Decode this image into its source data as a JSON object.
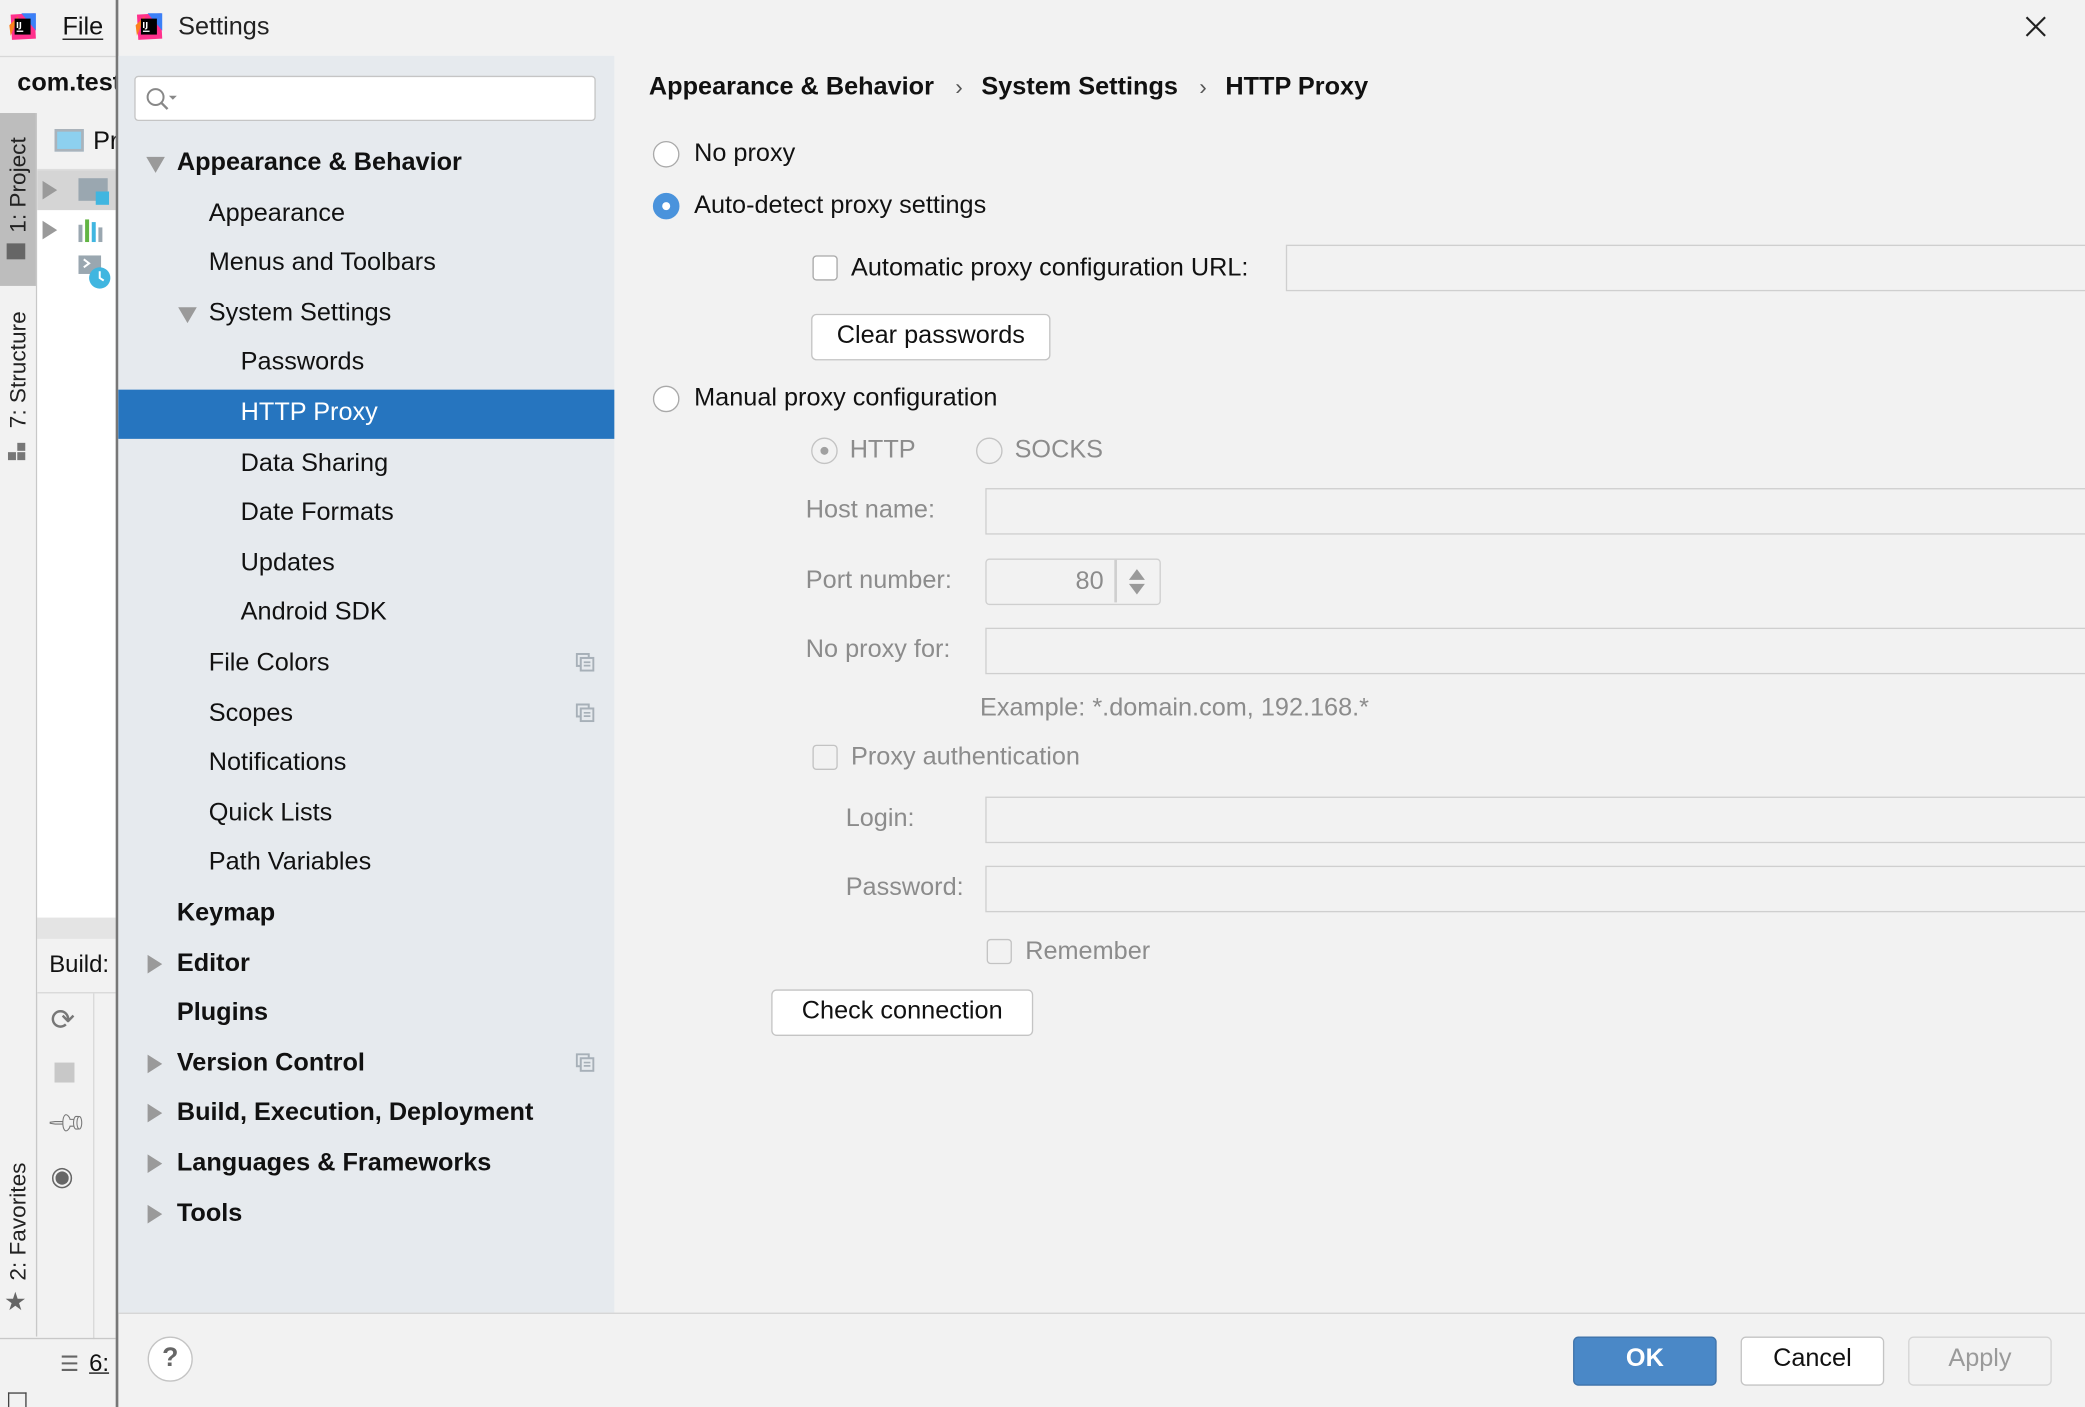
{
  "ide": {
    "menu_file": "File",
    "breadcrumb": "com.test",
    "project_header": "Pr",
    "tool_windows": {
      "project": "1: Project",
      "structure": "7: Structure",
      "favorites": "2: Favorites",
      "build": "Build:",
      "todo": "6:"
    }
  },
  "dialog": {
    "title": "Settings",
    "search": {
      "value": "",
      "placeholder": ""
    },
    "tree": [
      {
        "label": "Appearance & Behavior",
        "level": 0,
        "bold": true,
        "expanded": true
      },
      {
        "label": "Appearance",
        "level": 1
      },
      {
        "label": "Menus and Toolbars",
        "level": 1
      },
      {
        "label": "System Settings",
        "level": 1,
        "expanded": true
      },
      {
        "label": "Passwords",
        "level": 2
      },
      {
        "label": "HTTP Proxy",
        "level": 2,
        "selected": true
      },
      {
        "label": "Data Sharing",
        "level": 2
      },
      {
        "label": "Date Formats",
        "level": 2
      },
      {
        "label": "Updates",
        "level": 2
      },
      {
        "label": "Android SDK",
        "level": 2
      },
      {
        "label": "File Colors",
        "level": 1,
        "project_icon": true
      },
      {
        "label": "Scopes",
        "level": 1,
        "project_icon": true
      },
      {
        "label": "Notifications",
        "level": 1
      },
      {
        "label": "Quick Lists",
        "level": 1
      },
      {
        "label": "Path Variables",
        "level": 1
      },
      {
        "label": "Keymap",
        "level": 0,
        "bold": true
      },
      {
        "label": "Editor",
        "level": 0,
        "bold": true,
        "collapsed": true
      },
      {
        "label": "Plugins",
        "level": 0,
        "bold": true
      },
      {
        "label": "Version Control",
        "level": 0,
        "bold": true,
        "collapsed": true,
        "project_icon": true
      },
      {
        "label": "Build, Execution, Deployment",
        "level": 0,
        "bold": true,
        "collapsed": true
      },
      {
        "label": "Languages & Frameworks",
        "level": 0,
        "bold": true,
        "collapsed": true
      },
      {
        "label": "Tools",
        "level": 0,
        "bold": true,
        "collapsed": true
      }
    ],
    "breadcrumb": [
      "Appearance & Behavior",
      "System Settings",
      "HTTP Proxy"
    ],
    "breadcrumb_separator": "›",
    "proxy": {
      "no_proxy": "No proxy",
      "auto_detect": "Auto-detect proxy settings",
      "auto_config_url_label": "Automatic proxy configuration URL:",
      "auto_config_url_value": "",
      "auto_config_url_checked": false,
      "clear_passwords": "Clear passwords",
      "manual": "Manual proxy configuration",
      "selected_mode": "auto_detect",
      "type_http": "HTTP",
      "type_socks": "SOCKS",
      "selected_type": "HTTP",
      "host_label": "Host name:",
      "host_value": "",
      "port_label": "Port number:",
      "port_value": "80",
      "no_proxy_for_label": "No proxy for:",
      "no_proxy_for_value": "",
      "example": "Example: *.domain.com, 192.168.*",
      "auth_label": "Proxy authentication",
      "auth_checked": false,
      "login_label": "Login:",
      "login_value": "",
      "password_label": "Password:",
      "password_value": "",
      "remember_label": "Remember",
      "remember_checked": false,
      "check_connection": "Check connection"
    },
    "footer": {
      "help": "?",
      "ok": "OK",
      "cancel": "Cancel",
      "apply": "Apply"
    },
    "colors": {
      "selection": "#2675bf",
      "primary_button": "#4a88c7",
      "radio_on": "#4a93dc",
      "sidebar_bg": "#e6eaee"
    }
  }
}
